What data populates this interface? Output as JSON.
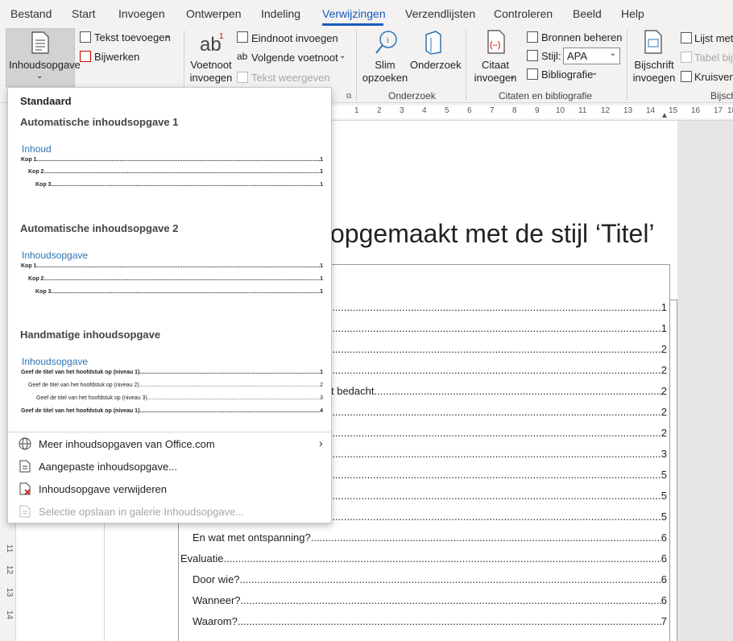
{
  "menu": {
    "tabs": [
      "Bestand",
      "Start",
      "Invoegen",
      "Ontwerpen",
      "Indeling",
      "Verwijzingen",
      "Verzendlijsten",
      "Controleren",
      "Beeld",
      "Help"
    ],
    "active_tab": "Verwijzingen"
  },
  "ribbon": {
    "toc_button": "Inhoudsopgave",
    "add_text": "Tekst toevoegen",
    "update": "Bijwerken",
    "footnote_line1": "Voetnoot",
    "footnote_line2": "invoegen",
    "endnote": "Eindnoot invoegen",
    "next_footnote": "Volgende voetnoot",
    "show_notes": "Tekst weergeven",
    "smart_lookup_line1": "Slim",
    "smart_lookup_line2": "opzoeken",
    "researcher": "Onderzoek",
    "research_group": "Onderzoek",
    "citation_line1": "Citaat",
    "citation_line2": "invoegen",
    "manage_sources": "Bronnen beheren",
    "style_label": "Stijl:",
    "style_value": "APA",
    "bibliography": "Bibliografie",
    "citations_group": "Citaten en bibliografie",
    "caption_line1": "Bijschrift",
    "caption_line2": "invoegen",
    "list_of": "Lijst met",
    "update_table": "Tabel bijw",
    "cross_ref": "Kruisverw",
    "captions_group": "Bijsch"
  },
  "ruler": {
    "numbers": [
      "1",
      "2",
      "3",
      "4",
      "5",
      "6",
      "7",
      "8",
      "9",
      "10",
      "11",
      "12",
      "13",
      "14",
      "15",
      "16",
      "17",
      "18"
    ],
    "vertical_numbers": [
      "11",
      "12",
      "13",
      "14"
    ]
  },
  "panel": {
    "heading": "Standaard",
    "section1_title": "Automatische inhoudsopgave 1",
    "section1_preview_title": "Inhoud",
    "section1_lines": [
      {
        "text": "Kop 1",
        "page": "1"
      },
      {
        "text": "Kop 2",
        "page": "1"
      },
      {
        "text": "Kop 3",
        "page": "1"
      }
    ],
    "section2_title": "Automatische inhoudsopgave 2",
    "section2_preview_title": "Inhoudsopgave",
    "section2_lines": [
      {
        "text": "Kop 1",
        "page": "1"
      },
      {
        "text": "Kop 2",
        "page": "1"
      },
      {
        "text": "Kop 3",
        "page": "1"
      }
    ],
    "section3_title": "Handmatige inhoudsopgave",
    "section3_preview_title": "Inhoudsopgave",
    "section3_lines": [
      {
        "text": "Geef de titel van het hoofdstuk op (niveau 1)",
        "page": "1"
      },
      {
        "text": "Geef de titel van het hoofdstuk op (niveau 2)",
        "page": "2"
      },
      {
        "text": "Geef de titel van het hoofdstuk op (niveau 3)",
        "page": "3"
      },
      {
        "text": "Geef de titel van het hoofdstuk op (niveau 1)",
        "page": "4"
      }
    ],
    "menu_items": {
      "more": "Meer inhoudsopgaven van Office.com",
      "custom": "Aangepaste inhoudsopgave...",
      "remove": "Inhoudsopgave verwijderen",
      "save": "Selectie opslaan in galerie Inhoudsopgave..."
    }
  },
  "document": {
    "title_visible": "opgemaakt met de stijl ‘Titel’",
    "toc_lines": [
      {
        "text": "",
        "page": "1"
      },
      {
        "text": "",
        "page": "1"
      },
      {
        "text": "",
        "page": "2"
      },
      {
        "text": "",
        "page": "2"
      },
      {
        "text": "t bedacht",
        "page": "2"
      },
      {
        "text": "",
        "page": "2"
      },
      {
        "text": "",
        "page": "2"
      },
      {
        "text": "",
        "page": "3"
      },
      {
        "text": "",
        "page": "5"
      },
      {
        "text": "",
        "page": "5"
      },
      {
        "text": "",
        "page": "5"
      },
      {
        "text": "En wat met ontspanning?",
        "page": "6"
      },
      {
        "text": "Evaluatie",
        "page": "6"
      },
      {
        "text": "Door wie?",
        "page": "6"
      },
      {
        "text": "Wanneer?",
        "page": "6"
      },
      {
        "text": "Waarom?",
        "page": "7"
      }
    ]
  }
}
